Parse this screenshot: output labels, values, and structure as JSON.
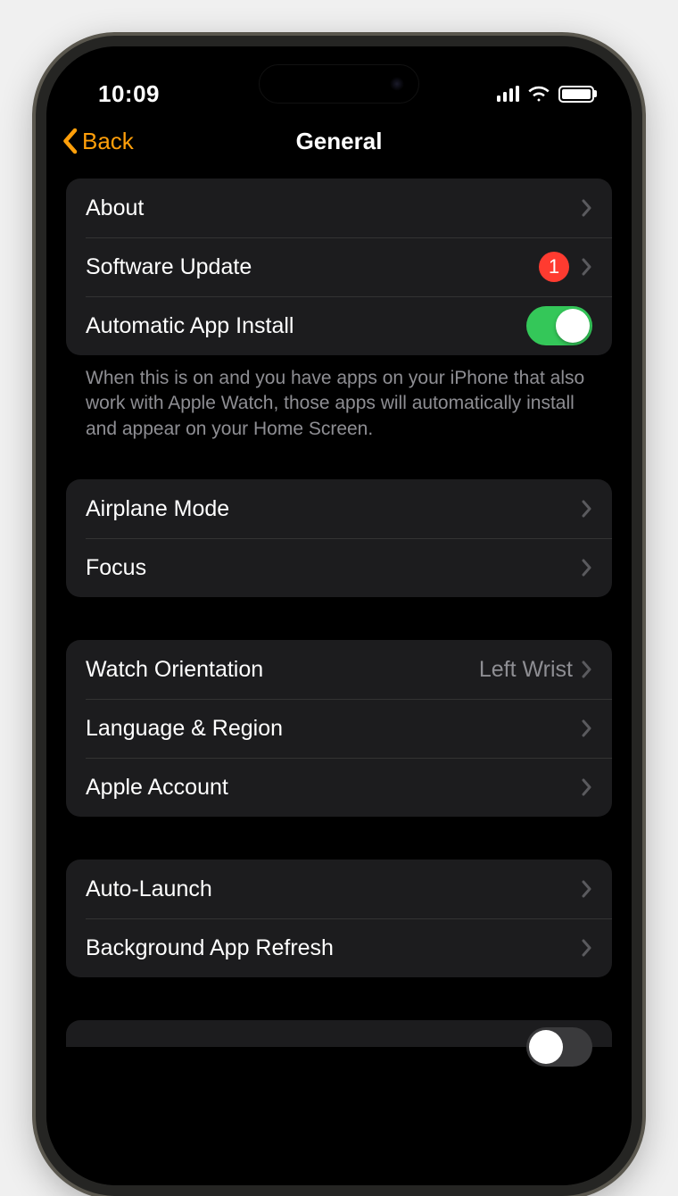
{
  "statusBar": {
    "time": "10:09"
  },
  "nav": {
    "back": "Back",
    "title": "General"
  },
  "group1": {
    "about": "About",
    "softwareUpdate": "Software Update",
    "badgeCount": "1",
    "autoInstall": "Automatic App Install"
  },
  "footer1": "When this is on and you have apps on your iPhone that also work with Apple Watch, those apps will automatically install and appear on your Home Screen.",
  "group2": {
    "airplane": "Airplane Mode",
    "focus": "Focus"
  },
  "group3": {
    "orientation": "Watch Orientation",
    "orientationValue": "Left Wrist",
    "language": "Language & Region",
    "account": "Apple Account"
  },
  "group4": {
    "autoLaunch": "Auto-Launch",
    "bgRefresh": "Background App Refresh"
  }
}
